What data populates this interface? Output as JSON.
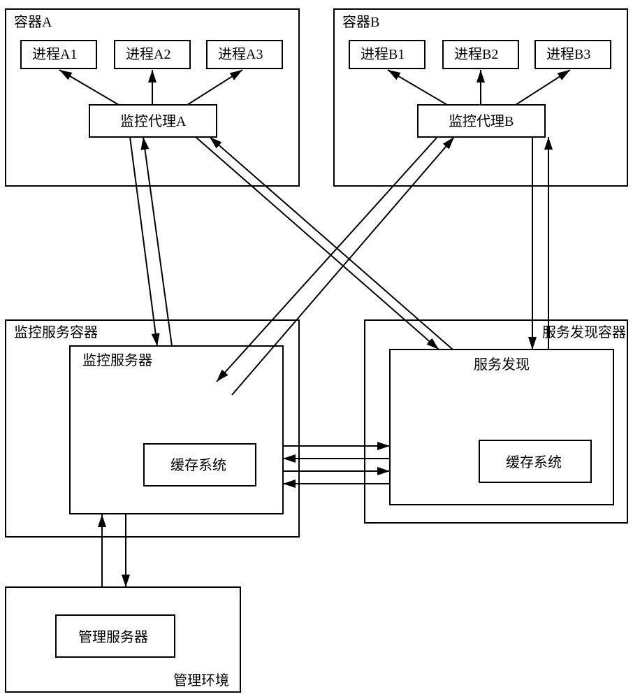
{
  "containerA": {
    "title": "容器A",
    "processes": [
      "进程A1",
      "进程A2",
      "进程A3"
    ],
    "agent": "监控代理A"
  },
  "containerB": {
    "title": "容器B",
    "processes": [
      "进程B1",
      "进程B2",
      "进程B3"
    ],
    "agent": "监控代理B"
  },
  "monitorServiceContainer": {
    "title": "监控服务容器",
    "server": "监控服务器",
    "cache": "缓存系统"
  },
  "serviceDiscoveryContainer": {
    "title": "服务发现容器",
    "service": "服务发现",
    "cache": "缓存系统"
  },
  "managementEnv": {
    "title": "管理环境",
    "server": "管理服务器"
  }
}
